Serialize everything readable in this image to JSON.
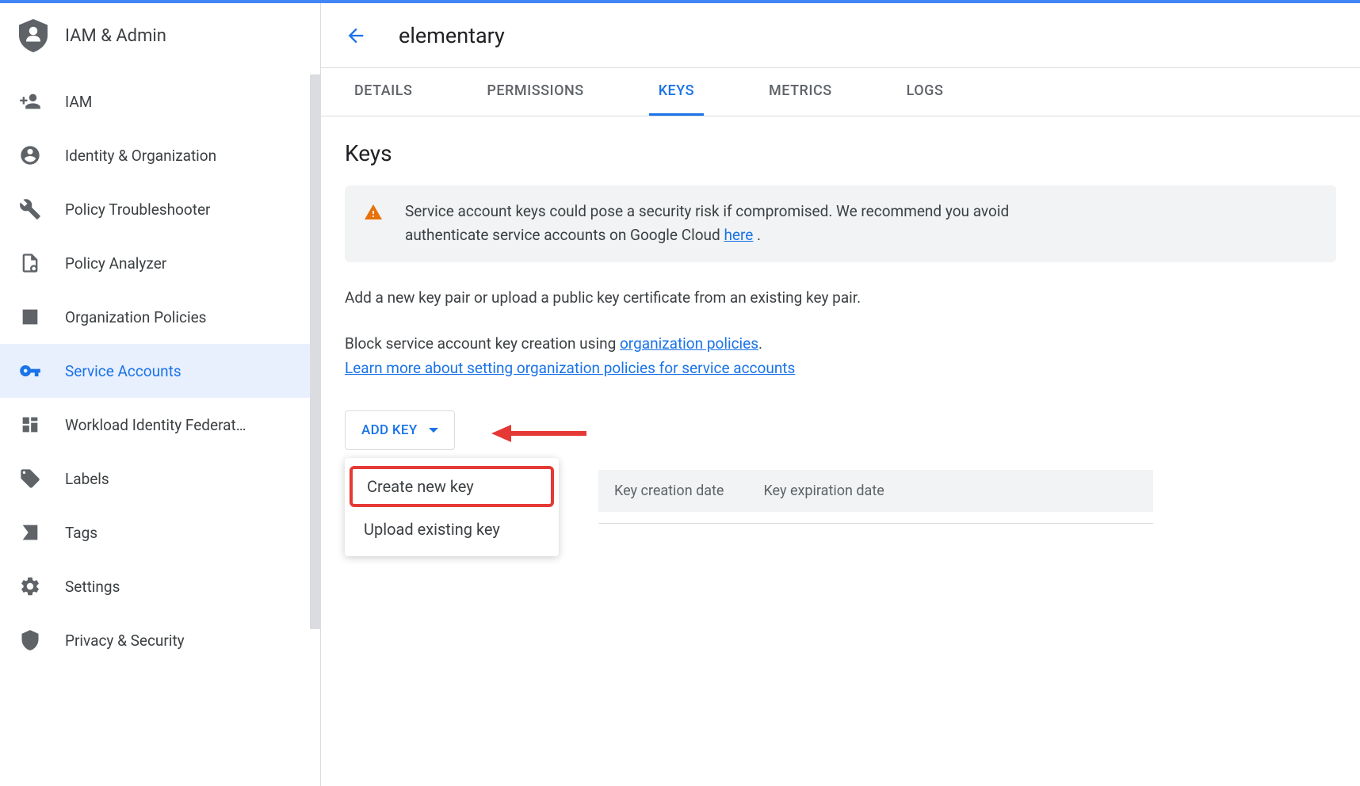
{
  "product": {
    "title": "IAM & Admin"
  },
  "sidebar": {
    "items": [
      {
        "label": "IAM",
        "icon": "add-user"
      },
      {
        "label": "Identity & Organization",
        "icon": "user-circle"
      },
      {
        "label": "Policy Troubleshooter",
        "icon": "wrench"
      },
      {
        "label": "Policy Analyzer",
        "icon": "document-search"
      },
      {
        "label": "Organization Policies",
        "icon": "document-lines"
      },
      {
        "label": "Service Accounts",
        "icon": "key",
        "active": true
      },
      {
        "label": "Workload Identity Federat…",
        "icon": "grid"
      },
      {
        "label": "Labels",
        "icon": "tag"
      },
      {
        "label": "Tags",
        "icon": "bookmark"
      },
      {
        "label": "Settings",
        "icon": "gear"
      },
      {
        "label": "Privacy & Security",
        "icon": "shield"
      }
    ]
  },
  "page": {
    "title": "elementary"
  },
  "tabs": [
    {
      "label": "DETAILS"
    },
    {
      "label": "PERMISSIONS"
    },
    {
      "label": "KEYS",
      "active": true
    },
    {
      "label": "METRICS"
    },
    {
      "label": "LOGS"
    }
  ],
  "keys": {
    "heading": "Keys",
    "warning_prefix": "Service account keys could pose a security risk if compromised. We recommend you avoid",
    "warning_line2_prefix": "authenticate service accounts on Google Cloud ",
    "warning_link": "here",
    "warning_suffix": " .",
    "info1": "Add a new key pair or upload a public key certificate from an existing key pair.",
    "info2_prefix": "Block service account key creation using ",
    "info2_link": "organization policies",
    "info2_suffix": ".",
    "info3_link": "Learn more about setting organization policies for service accounts",
    "addKeyButton": "ADD KEY",
    "dropdown": [
      {
        "label": "Create new key",
        "highlighted": true
      },
      {
        "label": "Upload existing key"
      }
    ],
    "tableHeaders": [
      "Key creation date",
      "Key expiration date"
    ]
  }
}
